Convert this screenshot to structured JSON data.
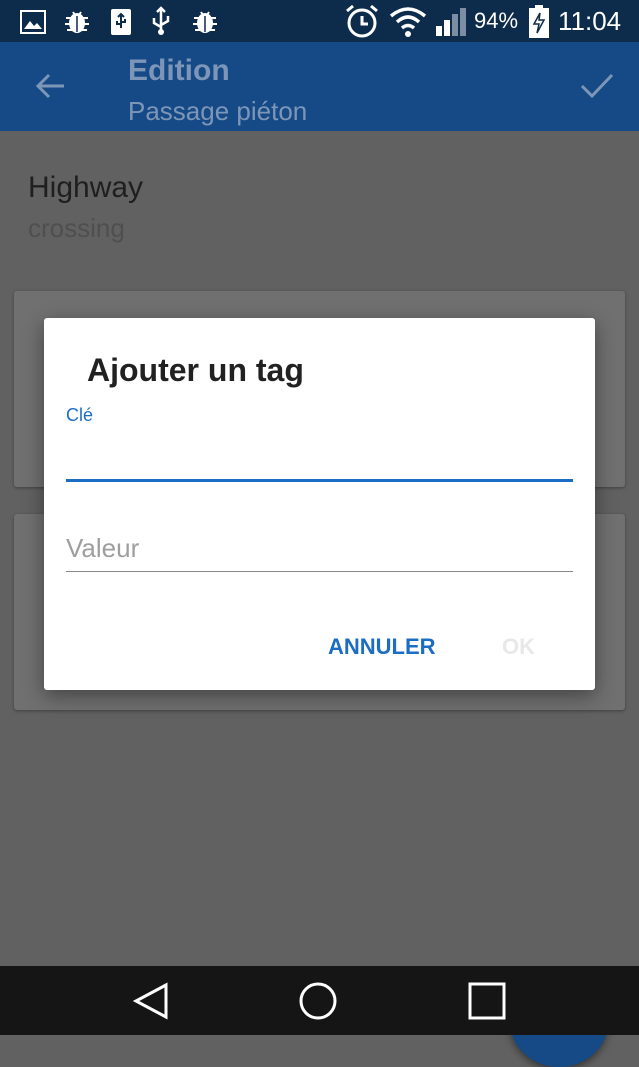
{
  "status_bar": {
    "icons": [
      "image-icon",
      "bug-icon",
      "usb-storage-icon",
      "usb-icon",
      "bug-icon",
      "alarm-icon",
      "wifi-icon",
      "signal-icon",
      "battery-charging-icon"
    ],
    "battery": "94%",
    "time": "11:04"
  },
  "app_bar": {
    "title": "Edition",
    "subtitle": "Passage piéton",
    "back_icon": "arrow-back-icon",
    "confirm_icon": "check-icon"
  },
  "content": {
    "highway_label": "Highway",
    "highway_value": "crossing"
  },
  "dialog": {
    "title": "Ajouter un tag",
    "key_label": "Clé",
    "key_value": "",
    "value_placeholder": "Valeur",
    "cancel": "ANNULER",
    "ok": "OK"
  },
  "fab": {
    "label": "+"
  },
  "nav_bar": {
    "icons": [
      "back-triangle-icon",
      "home-circle-icon",
      "recents-square-icon"
    ]
  },
  "colors": {
    "primary": "#154a86",
    "accent": "#1c6ec4",
    "statusbar": "#0d2b4a",
    "scrim_background": "#616161"
  }
}
